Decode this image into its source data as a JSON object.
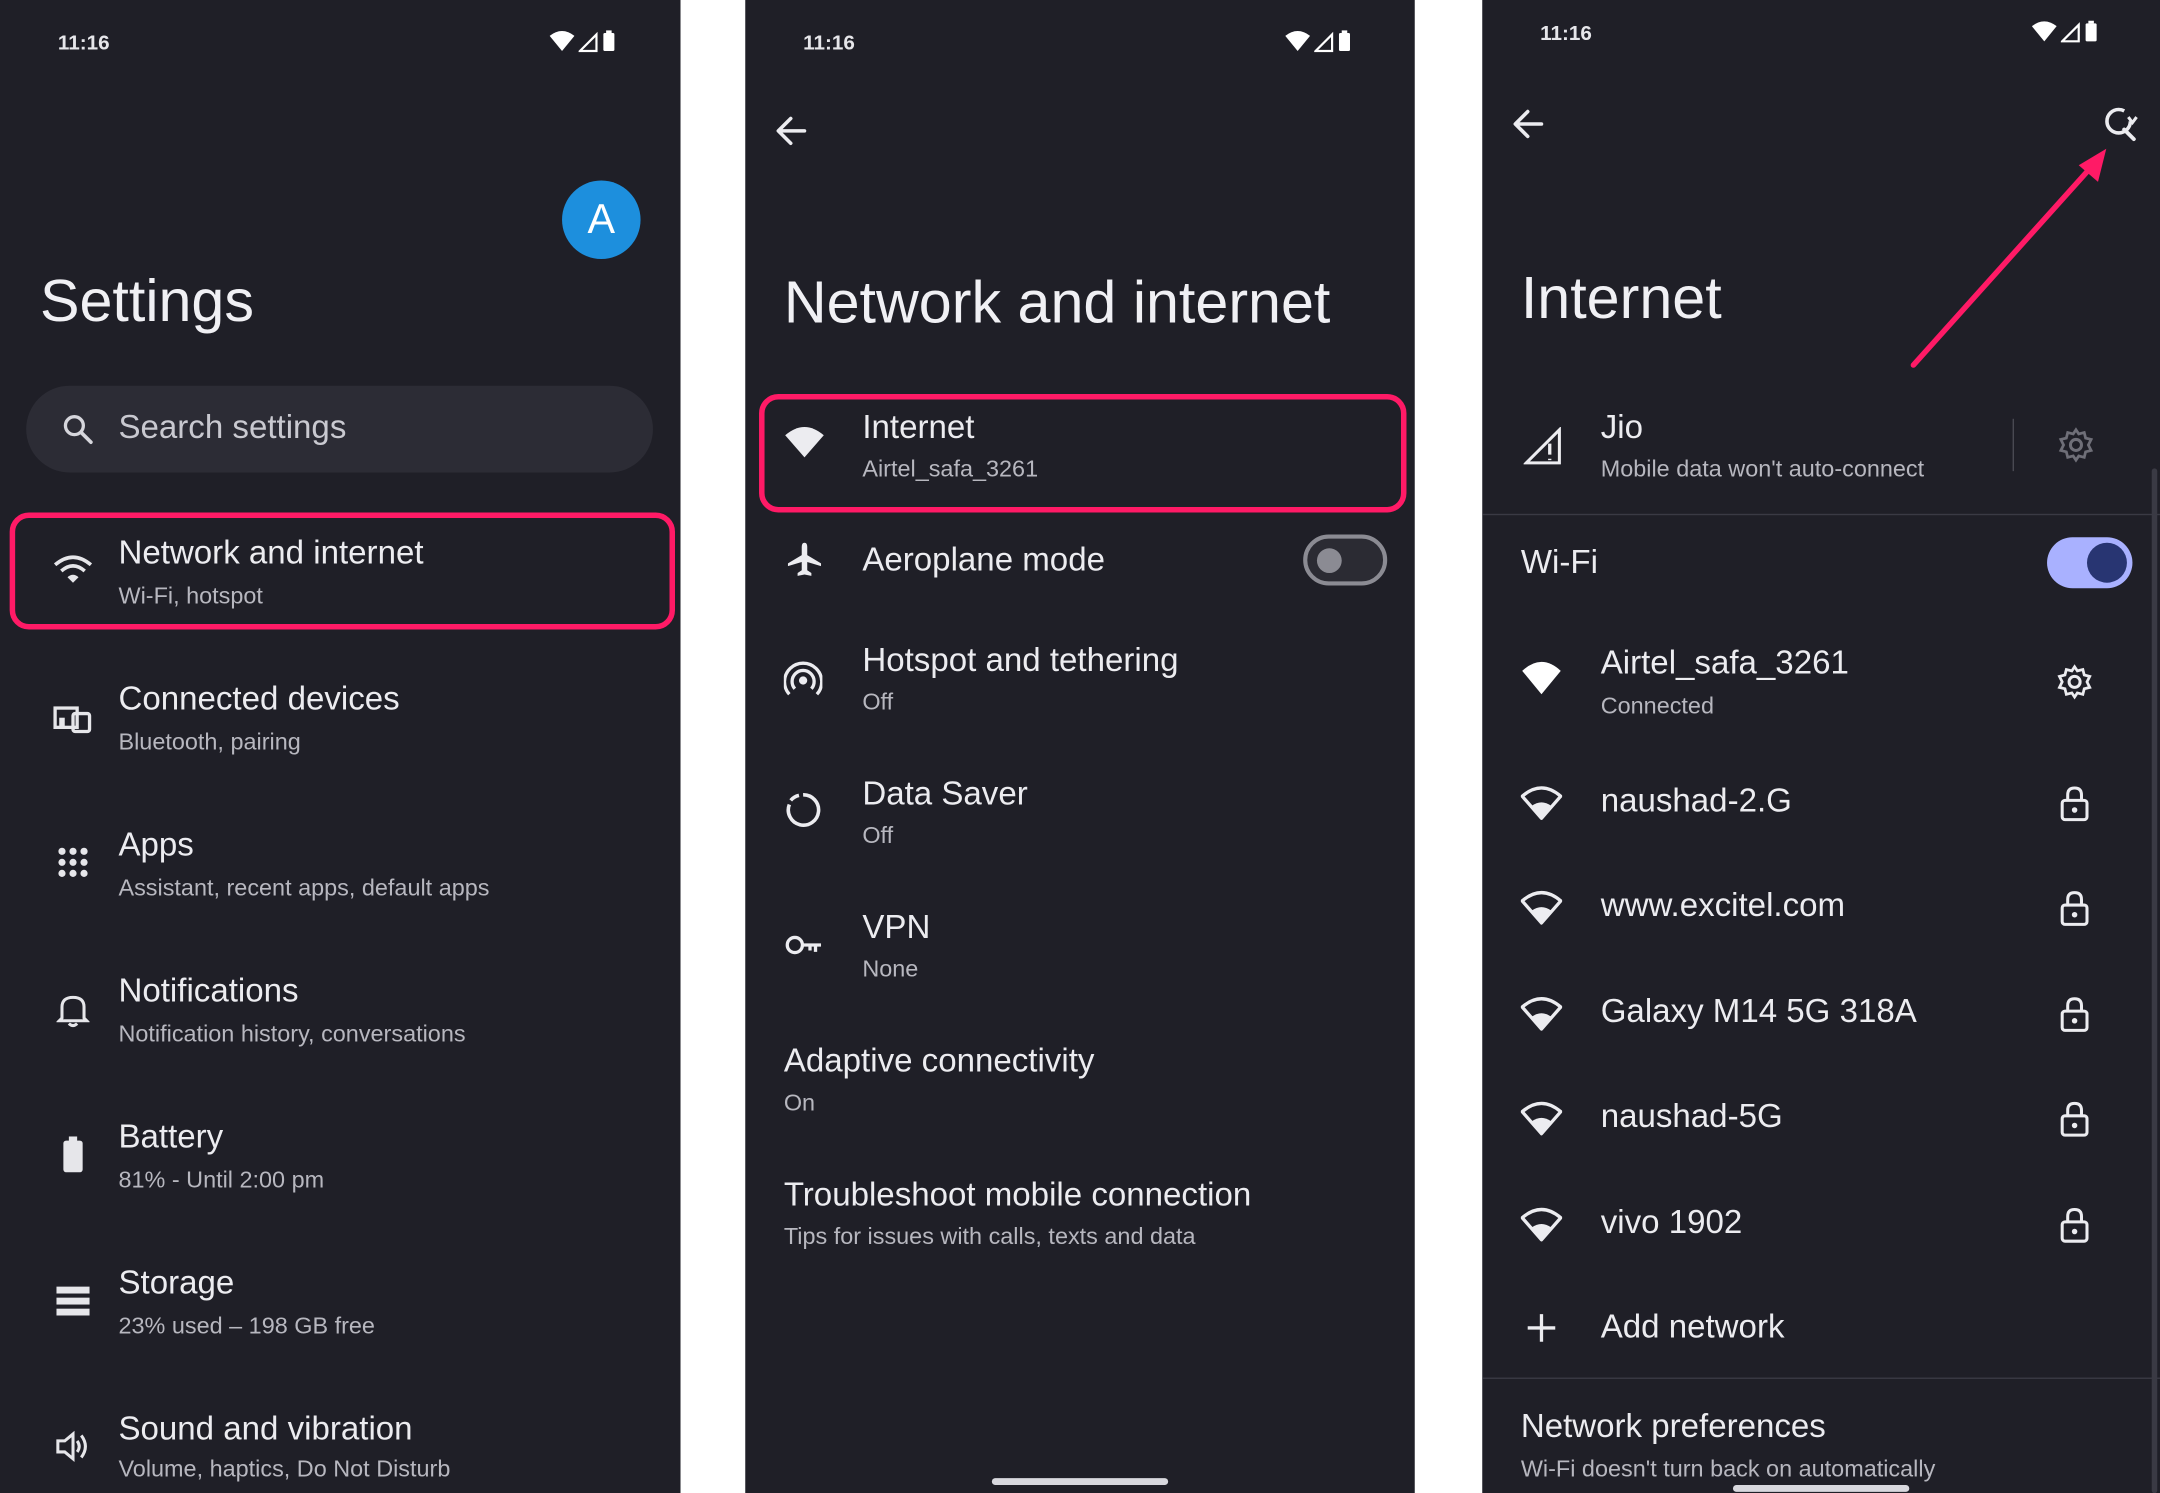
{
  "status": {
    "time": "11:16"
  },
  "screen1": {
    "avatar_letter": "A",
    "title": "Settings",
    "search_placeholder": "Search settings",
    "items": [
      {
        "title": "Network and internet",
        "subtitle": "Wi-Fi, hotspot",
        "icon": "wifi-icon"
      },
      {
        "title": "Connected devices",
        "subtitle": "Bluetooth, pairing",
        "icon": "devices-icon"
      },
      {
        "title": "Apps",
        "subtitle": "Assistant, recent apps, default apps",
        "icon": "apps-grid-icon"
      },
      {
        "title": "Notifications",
        "subtitle": "Notification history, conversations",
        "icon": "bell-icon"
      },
      {
        "title": "Battery",
        "subtitle": "81% - Until 2:00 pm",
        "icon": "battery-icon"
      },
      {
        "title": "Storage",
        "subtitle": "23% used – 198 GB free",
        "icon": "storage-icon"
      },
      {
        "title": "Sound and vibration",
        "subtitle": "Volume, haptics, Do Not Disturb",
        "icon": "volume-icon"
      }
    ]
  },
  "screen2": {
    "title": "Network and internet",
    "items": [
      {
        "title": "Internet",
        "subtitle": "Airtel_safa_3261",
        "icon": "wifi-icon"
      },
      {
        "title": "Aeroplane mode",
        "subtitle": "",
        "icon": "airplane-icon"
      },
      {
        "title": "Hotspot and tethering",
        "subtitle": "Off",
        "icon": "hotspot-icon"
      },
      {
        "title": "Data Saver",
        "subtitle": "Off",
        "icon": "data-saver-icon"
      },
      {
        "title": "VPN",
        "subtitle": "None",
        "icon": "vpn-key-icon"
      },
      {
        "title": "Adaptive connectivity",
        "subtitle": "On",
        "icon": ""
      },
      {
        "title": "Troubleshoot mobile connection",
        "subtitle": "Tips for issues with calls, texts and data",
        "icon": ""
      }
    ]
  },
  "screen3": {
    "title": "Internet",
    "mobile": {
      "title": "Jio",
      "subtitle": "Mobile data won't auto-connect"
    },
    "wifi_label": "Wi-Fi",
    "connected": {
      "name": "Airtel_safa_3261",
      "status": "Connected"
    },
    "networks": [
      "naushad-2.G",
      "www.excitel.com",
      "Galaxy M14 5G 318A",
      "naushad-5G",
      "vivo 1902"
    ],
    "add_network": "Add network",
    "prefs": {
      "title": "Network preferences",
      "subtitle": "Wi-Fi doesn't turn back on automatically"
    }
  },
  "colors": {
    "background": "#1f1f27",
    "highlight": "#ff1a66",
    "accent": "#a9b1ff",
    "avatar": "#1d8fdd"
  }
}
